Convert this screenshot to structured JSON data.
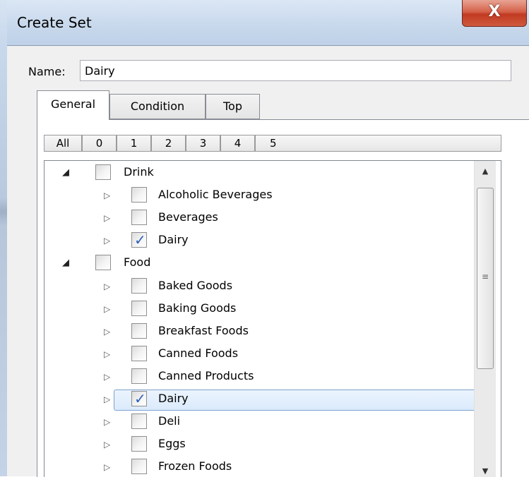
{
  "window": {
    "title": "Create Set",
    "close_glyph": "X"
  },
  "name_field": {
    "label": "Name:",
    "value": "Dairy"
  },
  "tabs": [
    {
      "label": "General",
      "active": true
    },
    {
      "label": "Condition",
      "active": false
    },
    {
      "label": "Top",
      "active": false
    }
  ],
  "level_buttons": [
    "All",
    "0",
    "1",
    "2",
    "3",
    "4",
    "5"
  ],
  "tree": {
    "rows": [
      {
        "label": "Drink",
        "level": 0,
        "expanded": true,
        "checked": false,
        "selected": false
      },
      {
        "label": "Alcoholic Beverages",
        "level": 1,
        "expanded": false,
        "checked": false,
        "selected": false
      },
      {
        "label": "Beverages",
        "level": 1,
        "expanded": false,
        "checked": false,
        "selected": false
      },
      {
        "label": "Dairy",
        "level": 1,
        "expanded": false,
        "checked": true,
        "selected": false
      },
      {
        "label": "Food",
        "level": 0,
        "expanded": true,
        "checked": false,
        "selected": false
      },
      {
        "label": "Baked Goods",
        "level": 1,
        "expanded": false,
        "checked": false,
        "selected": false
      },
      {
        "label": "Baking Goods",
        "level": 1,
        "expanded": false,
        "checked": false,
        "selected": false
      },
      {
        "label": "Breakfast Foods",
        "level": 1,
        "expanded": false,
        "checked": false,
        "selected": false
      },
      {
        "label": "Canned Foods",
        "level": 1,
        "expanded": false,
        "checked": false,
        "selected": false
      },
      {
        "label": "Canned Products",
        "level": 1,
        "expanded": false,
        "checked": false,
        "selected": false
      },
      {
        "label": "Dairy",
        "level": 1,
        "expanded": false,
        "checked": true,
        "selected": true
      },
      {
        "label": "Deli",
        "level": 1,
        "expanded": false,
        "checked": false,
        "selected": false
      },
      {
        "label": "Eggs",
        "level": 1,
        "expanded": false,
        "checked": false,
        "selected": false
      },
      {
        "label": "Frozen Foods",
        "level": 1,
        "expanded": false,
        "checked": false,
        "selected": false
      }
    ]
  },
  "icons": {
    "expanded": "triangle-down-right-icon",
    "collapsed": "triangle-right-outline-icon",
    "check": "checkmark-icon",
    "scroll_up": "scroll-up-arrow-icon",
    "scroll_down": "scroll-down-arrow-icon",
    "grip": "scroll-grip-icon"
  },
  "colors": {
    "titlebar": "#c7d8ec",
    "close_button": "#c13a21",
    "selection_border": "#7da2ce",
    "selection_fill": "#dbeafc",
    "check": "#2a5fb8"
  }
}
